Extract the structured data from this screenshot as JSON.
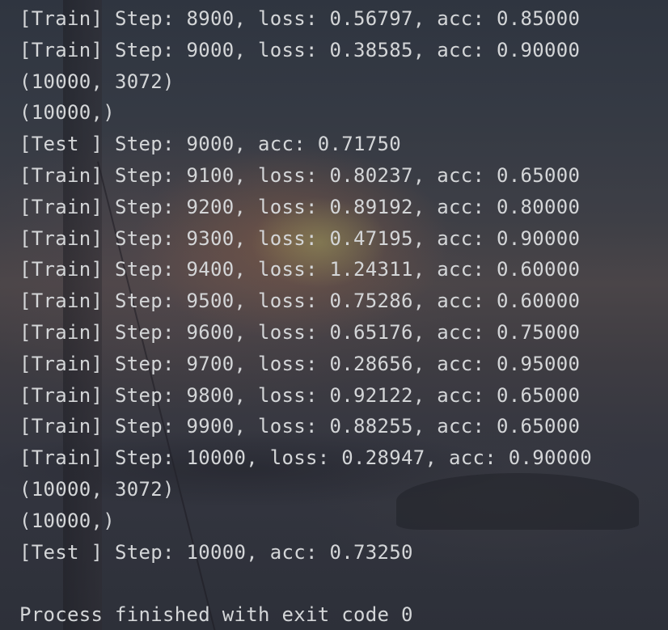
{
  "console": {
    "lines_before_gap": [
      "[Train] Step: 8900, loss: 0.56797, acc: 0.85000",
      "[Train] Step: 9000, loss: 0.38585, acc: 0.90000",
      "(10000, 3072)",
      "(10000,)",
      "[Test ] Step: 9000, acc: 0.71750",
      "[Train] Step: 9100, loss: 0.80237, acc: 0.65000",
      "[Train] Step: 9200, loss: 0.89192, acc: 0.80000",
      "[Train] Step: 9300, loss: 0.47195, acc: 0.90000",
      "[Train] Step: 9400, loss: 1.24311, acc: 0.60000",
      "[Train] Step: 9500, loss: 0.75286, acc: 0.60000",
      "[Train] Step: 9600, loss: 0.65176, acc: 0.75000",
      "[Train] Step: 9700, loss: 0.28656, acc: 0.95000",
      "[Train] Step: 9800, loss: 0.92122, acc: 0.65000",
      "[Train] Step: 9900, loss: 0.88255, acc: 0.65000",
      "[Train] Step: 10000, loss: 0.28947, acc: 0.90000",
      "(10000, 3072)",
      "(10000,)",
      "[Test ] Step: 10000, acc: 0.73250"
    ],
    "exit_message": "Process finished with exit code 0"
  },
  "colors": {
    "text": "#d4d6d8",
    "background": "#353a44"
  }
}
